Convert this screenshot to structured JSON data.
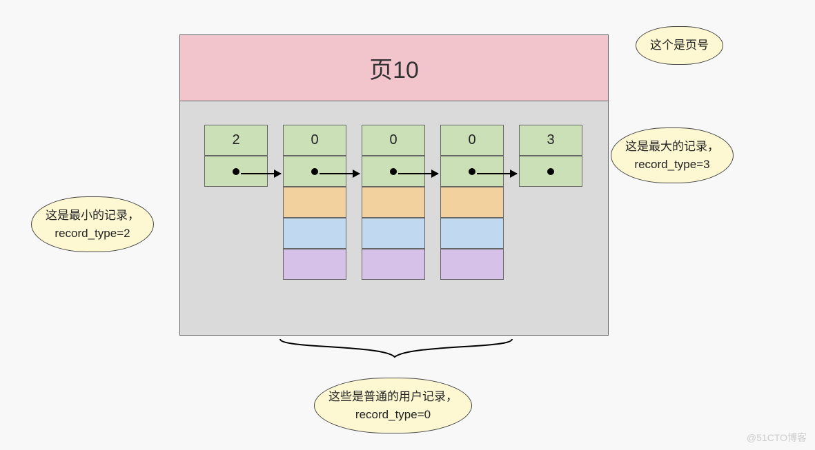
{
  "header": {
    "title": "页10"
  },
  "records": [
    {
      "type": "2",
      "extra_rows": 0
    },
    {
      "type": "0",
      "extra_rows": 3
    },
    {
      "type": "0",
      "extra_rows": 3
    },
    {
      "type": "0",
      "extra_rows": 3
    },
    {
      "type": "3",
      "extra_rows": 0
    }
  ],
  "callouts": {
    "page_number": "这个是页号",
    "min_record": "这是最小的记录，\nrecord_type=2",
    "max_record": "这是最大的记录，\nrecord_type=3",
    "user_records": "这些是普通的用户记录，\nrecord_type=0"
  },
  "watermark": "@51CTO博客"
}
